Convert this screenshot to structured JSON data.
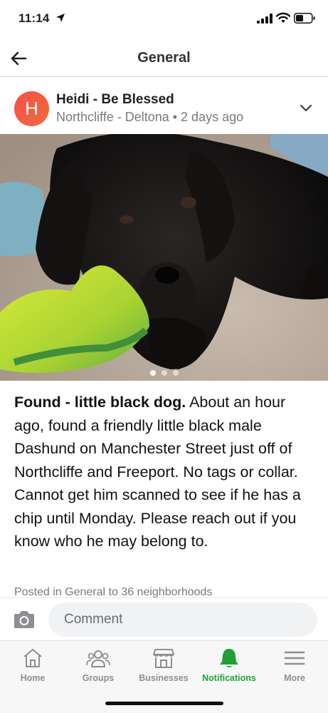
{
  "status_bar": {
    "time": "11:14",
    "icons": [
      "location-arrow-icon",
      "signal-icon",
      "wifi-icon",
      "battery-icon"
    ]
  },
  "header": {
    "title": "General",
    "back_icon": "back-arrow-icon"
  },
  "post": {
    "avatar_initial": "H",
    "author": "Heidi - Be Blessed",
    "meta": "Northcliffe - Deltona • 2 days ago",
    "menu_icon": "chevron-down-icon",
    "photo_pages": 3,
    "photo_active_page": 1,
    "headline": "Found - little black dog.",
    "body": " About an hour ago, found a friendly little black male Dashund on Manchester Street just off of Northcliffe and Freeport. No tags or collar.  Cannot get him scanned to see if he has a chip until Monday.  Please reach out if you know who he may belong to.",
    "posted_in": "Posted in General to 36 neighborhoods"
  },
  "comment": {
    "placeholder": "Comment",
    "camera_icon": "camera-icon"
  },
  "tabs": [
    {
      "label": "Home",
      "icon": "home-icon",
      "active": false
    },
    {
      "label": "Groups",
      "icon": "groups-icon",
      "active": false
    },
    {
      "label": "Businesses",
      "icon": "businesses-icon",
      "active": false
    },
    {
      "label": "Notifications",
      "icon": "bell-icon",
      "active": true
    },
    {
      "label": "More",
      "icon": "menu-icon",
      "active": false
    }
  ],
  "colors": {
    "accent": "#21a038",
    "avatar": "#f4504a",
    "muted_text": "#7a7a7a"
  }
}
